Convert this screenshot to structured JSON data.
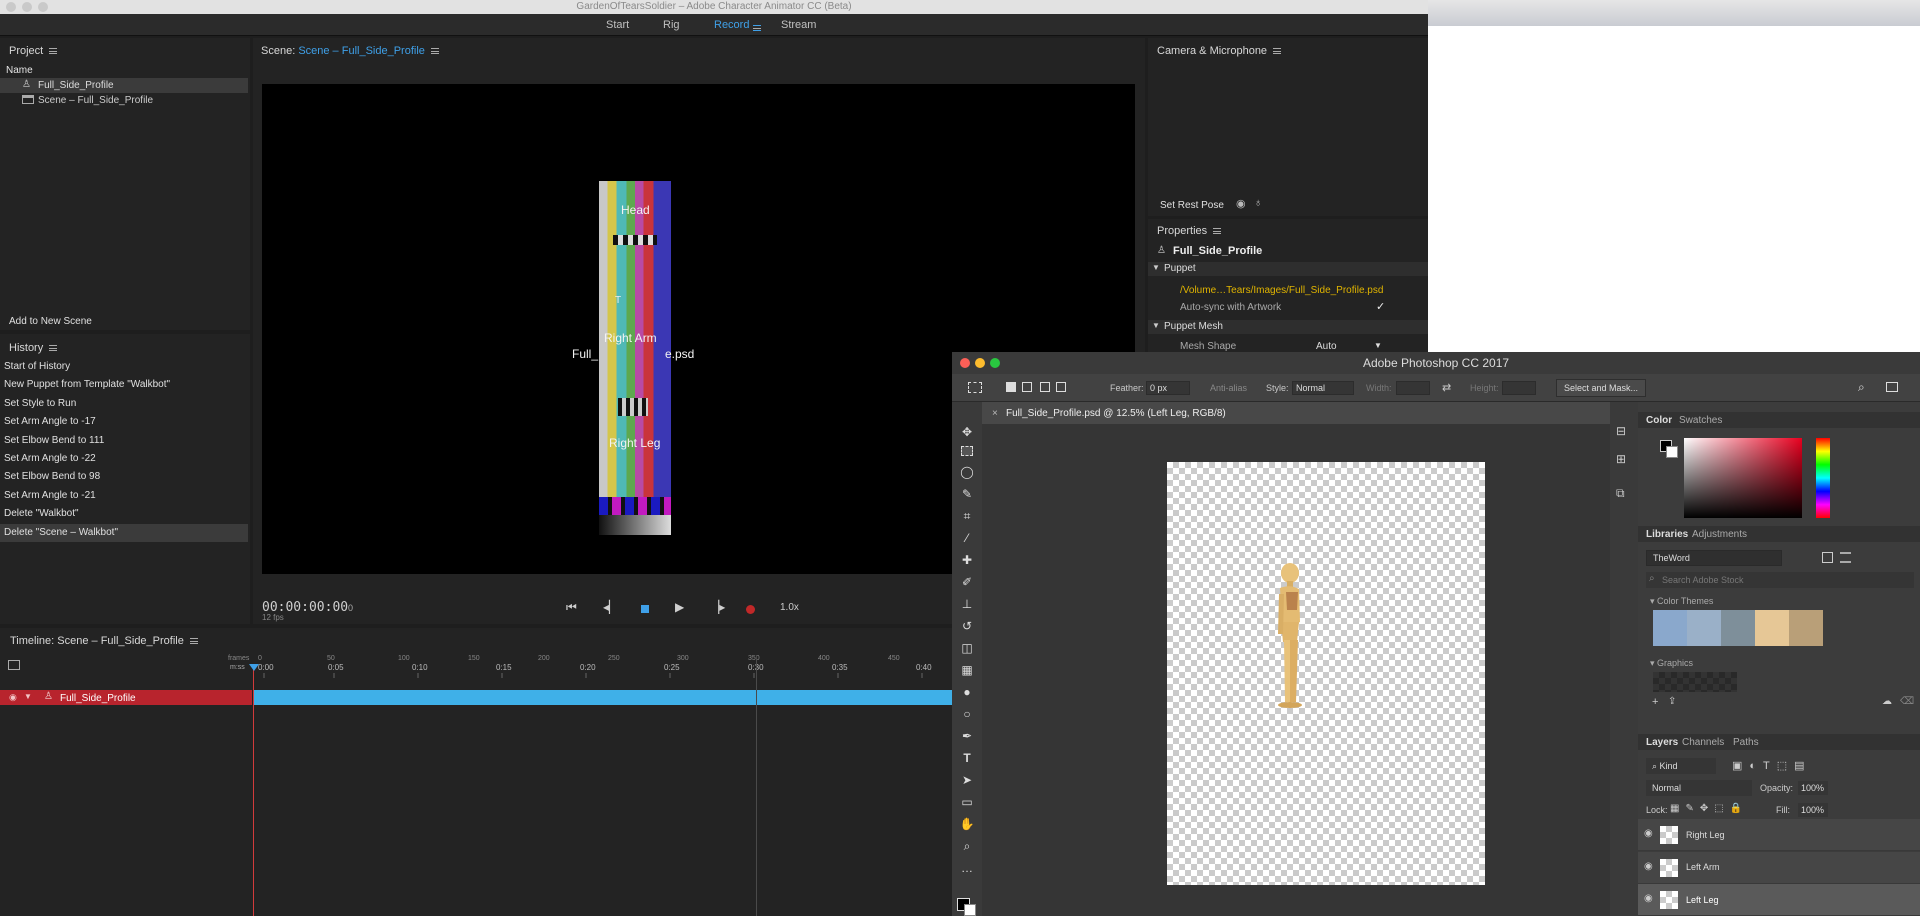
{
  "ch": {
    "title": "GardenOfTearsSoldier – Adobe Character Animator CC (Beta)",
    "menu": {
      "start": "Start",
      "rig": "Rig",
      "record": "Record",
      "stream": "Stream"
    },
    "project": {
      "title": "Project",
      "name_col": "Name",
      "items": [
        "Full_Side_Profile",
        "Scene – Full_Side_Profile"
      ],
      "add_scene": "Add to New Scene"
    },
    "history": {
      "title": "History",
      "items": [
        "Start of History",
        "New Puppet from Template \"Walkbot\"",
        "Set Style to Run",
        "Set Arm Angle to -17",
        "Set Elbow Bend to 111",
        "Set Arm Angle to -22",
        "Set Elbow Bend to 98",
        "Set Arm Angle to -21",
        "Delete \"Walkbot\"",
        "Delete \"Scene – Walkbot\""
      ]
    },
    "scene": {
      "label": "Scene:",
      "name": "Scene – Full_Side_Profile",
      "overlay_head": "Head",
      "overlay_right_arm": "Right Arm",
      "overlay_right_leg": "Right Leg",
      "overlay_psd_left": "Full_",
      "overlay_psd_right": "e.psd",
      "overlay_misc": "T",
      "timecode": "00:00:00:00",
      "frame": "0",
      "fps": "12 fps",
      "speed": "1.0x"
    },
    "camera": {
      "title": "Camera & Microphone",
      "set_rest_pose": "Set Rest Pose"
    },
    "properties": {
      "title": "Properties",
      "puppet_name": "Full_Side_Profile",
      "puppet_section": "Puppet",
      "path": "/Volume…Tears/Images/Full_Side_Profile.psd",
      "autosync": "Auto-sync with Artwork",
      "autosync_checked": true,
      "mesh_section": "Puppet Mesh",
      "mesh_shape_label": "Mesh Shape",
      "mesh_shape_value": "Auto"
    },
    "timeline": {
      "title": "Timeline: Scene – Full_Side_Profile",
      "frames_label": "frames",
      "mss_label": "m:ss",
      "frame_ticks": [
        "0",
        "50",
        "100",
        "150",
        "200",
        "250",
        "300",
        "350",
        "400",
        "450"
      ],
      "time_ticks": [
        "0:00",
        "0:05",
        "0:10",
        "0:15",
        "0:20",
        "0:25",
        "0:30",
        "0:35",
        "0:40"
      ],
      "track": "Full_Side_Profile"
    }
  },
  "ps": {
    "title": "Adobe Photoshop CC 2017",
    "options": {
      "feather_label": "Feather:",
      "feather_value": "0 px",
      "antialias": "Anti-alias",
      "style_label": "Style:",
      "style_value": "Normal",
      "width_label": "Width:",
      "height_label": "Height:",
      "select_mask": "Select and Mask..."
    },
    "doc_tab": "Full_Side_Profile.psd @ 12.5% (Left Leg, RGB/8)",
    "color_tabs": [
      "Color",
      "Swatches"
    ],
    "lib_tabs": [
      "Libraries",
      "Adjustments"
    ],
    "library_name": "TheWord",
    "search_placeholder": "Search Adobe Stock",
    "color_themes": "Color Themes",
    "theme_colors": [
      "#8aa8cc",
      "#9ab0c8",
      "#7e8f9a",
      "#e6c796",
      "#b99f78"
    ],
    "graphics": "Graphics",
    "layer_tabs": [
      "Layers",
      "Channels",
      "Paths"
    ],
    "kind": "Kind",
    "blend": "Normal",
    "opacity_label": "Opacity:",
    "opacity": "100%",
    "lock_label": "Lock:",
    "fill_label": "Fill:",
    "fill": "100%",
    "layers": [
      "Right Leg",
      "Left Arm",
      "Left Leg"
    ]
  },
  "colors": {
    "accent": "#3fa0e8",
    "track": "#3fb0e8",
    "track_head": "#b8242d",
    "playhead": "#d13b3b",
    "path": "#e0b400"
  }
}
